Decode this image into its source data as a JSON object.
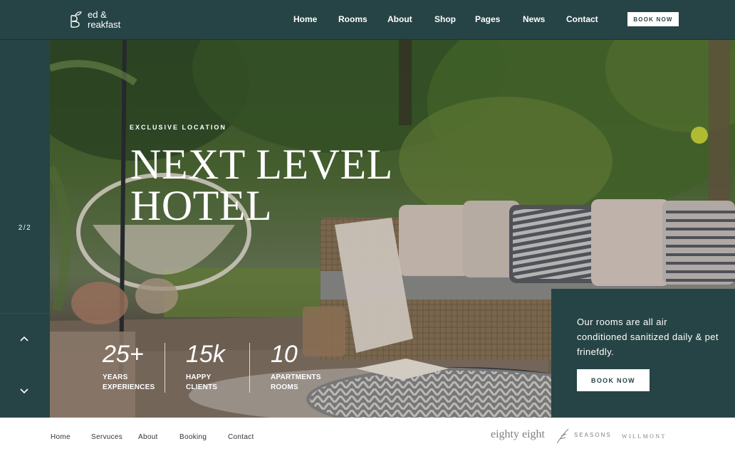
{
  "brand": {
    "line1": "ed &",
    "line2": "reakfast",
    "logo_icon": "leaf-b-monogram-icon"
  },
  "nav": {
    "items": [
      "Home",
      "Rooms",
      "About",
      "Shop",
      "Pages",
      "News",
      "Contact"
    ],
    "cta": "BOOK NOW"
  },
  "rail": {
    "counter": "2/2",
    "prev_icon": "chevron-up-icon",
    "next_icon": "chevron-down-icon"
  },
  "hero": {
    "eyebrow": "EXCLUSIVE LOCATION",
    "title_line1": "NEXT LEVEL",
    "title_line2": "HOTEL",
    "stats": [
      {
        "value": "25+",
        "label_line1": "YEARS",
        "label_line2": "EXPERIENCES"
      },
      {
        "value": "15k",
        "label_line1": "HAPPY",
        "label_line2": "CLIENTS"
      },
      {
        "value": "10",
        "label_line1": "APARTMENTS",
        "label_line2": "ROOMS"
      }
    ]
  },
  "info": {
    "text": "Our rooms are all air conditioned sanitized daily & pet frinefdly.",
    "cta": "BOOK NOW"
  },
  "footer": {
    "links": [
      "Home",
      "Servuces",
      "About",
      "Booking",
      "Contact"
    ],
    "partners": [
      "eighty eight",
      "SEASONS",
      "WILLMONT"
    ]
  },
  "colors": {
    "primary": "#264445",
    "white": "#ffffff"
  }
}
